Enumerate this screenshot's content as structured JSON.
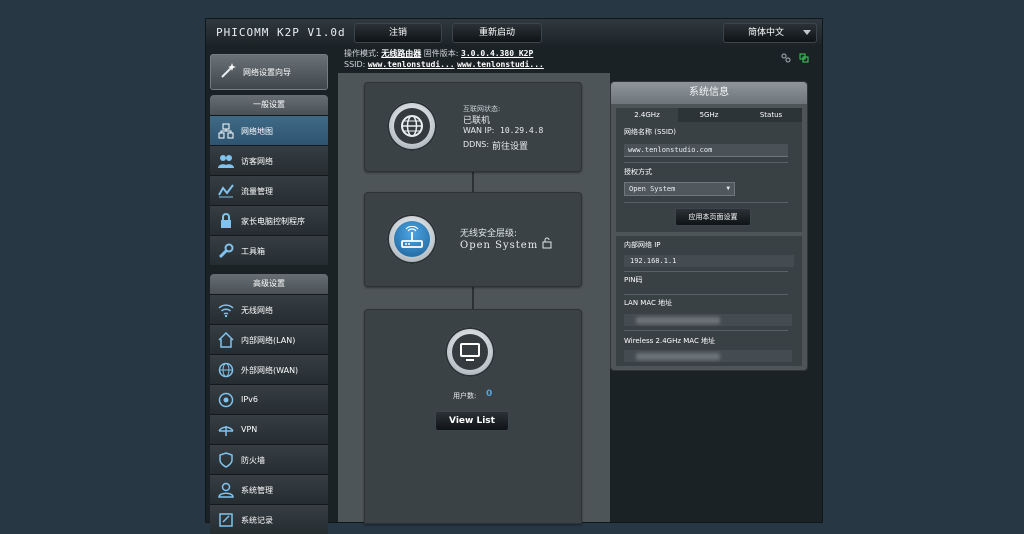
{
  "header": {
    "brand": "PHICOMM K2P V1.0d",
    "logout_label": "注销",
    "reboot_label": "重新启动",
    "language": "简体中文"
  },
  "status_line": {
    "mode_label": "操作模式:",
    "mode_value": "无线路由器",
    "firmware_label": "固件版本:",
    "firmware_value": "3.0.0.4.380_K2P",
    "ssid_label": "SSID:",
    "ssid_1": "www.tenlonstudi...",
    "ssid_2": "www.tenlonstudi..."
  },
  "sidebar": {
    "quick_setup": "网络设置向导",
    "general_title": "一般设置",
    "general_items": [
      {
        "label": "网络地图",
        "icon": "network-map-icon"
      },
      {
        "label": "访客网络",
        "icon": "guest-network-icon"
      },
      {
        "label": "流量管理",
        "icon": "traffic-icon"
      },
      {
        "label": "家长电脑控制程序",
        "icon": "lock-icon"
      },
      {
        "label": "工具箱",
        "icon": "wrench-icon"
      }
    ],
    "advanced_title": "高级设置",
    "advanced_items": [
      {
        "label": "无线网络",
        "icon": "wifi-icon"
      },
      {
        "label": "内部网络(LAN)",
        "icon": "home-icon"
      },
      {
        "label": "外部网络(WAN)",
        "icon": "globe-icon"
      },
      {
        "label": "IPv6",
        "icon": "ipv6-icon"
      },
      {
        "label": "VPN",
        "icon": "vpn-icon"
      },
      {
        "label": "防火墙",
        "icon": "shield-icon"
      },
      {
        "label": "系统管理",
        "icon": "admin-icon"
      },
      {
        "label": "系统记录",
        "icon": "log-icon"
      }
    ]
  },
  "map": {
    "internet_status_label": "互联网状态:",
    "internet_status_value": "已联机",
    "wan_ip_label": "WAN IP:",
    "wan_ip_value": "10.29.4.8",
    "ddns_label": "DDNS:",
    "ddns_value": "前往设置",
    "security_label": "无线安全层级:",
    "security_value": "Open System",
    "clients_label": "用户数:",
    "clients_value": "0",
    "view_list": "View List"
  },
  "sysinfo": {
    "title": "系统信息",
    "tabs": [
      "2.4GHz",
      "5GHz",
      "Status"
    ],
    "ssid_label": "网络名称 (SSID)",
    "ssid_value": "www.tenlonstudio.com",
    "auth_label": "授权方式",
    "auth_value": "Open System",
    "apply_label": "应用本页面设置",
    "lan_ip_label": "内部网络 IP",
    "lan_ip_value": "192.168.1.1",
    "pin_label": "PIN码",
    "lan_mac_label": "LAN MAC 地址",
    "wl_mac_label": "Wireless 2.4GHz MAC 地址"
  },
  "colors": {
    "background": "#273744",
    "active_item": "#3f6a86",
    "accent_blue": "#4ca6e5",
    "status_green": "#3fd15a"
  }
}
